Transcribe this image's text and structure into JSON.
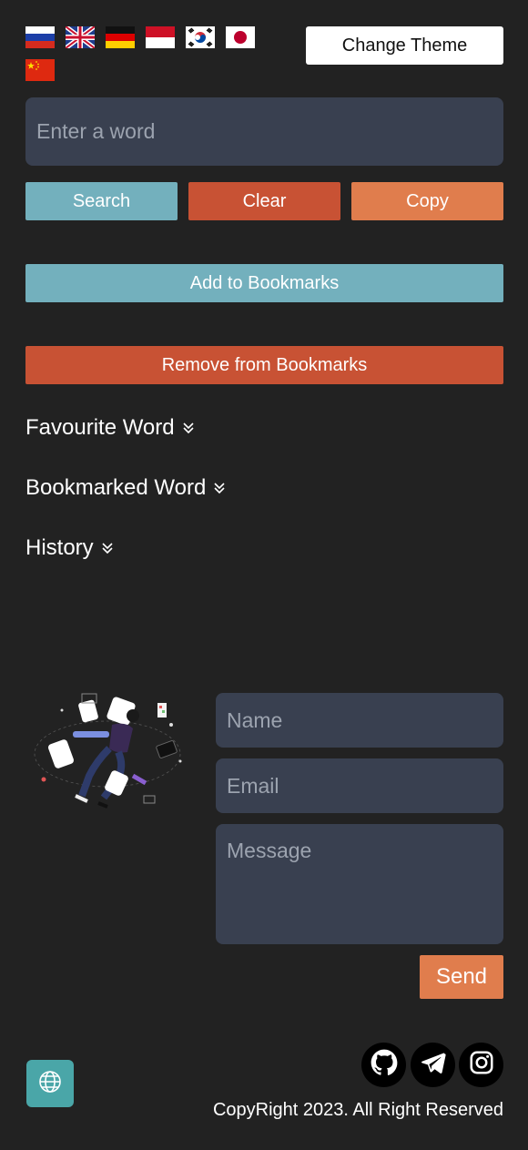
{
  "languages": [
    {
      "code": "ru",
      "icon": "russia-flag-icon"
    },
    {
      "code": "en",
      "icon": "uk-flag-icon"
    },
    {
      "code": "de",
      "icon": "germany-flag-icon"
    },
    {
      "code": "id",
      "icon": "indonesia-flag-icon"
    },
    {
      "code": "ko",
      "icon": "south-korea-flag-icon"
    },
    {
      "code": "ja",
      "icon": "japan-flag-icon"
    },
    {
      "code": "zh",
      "icon": "china-flag-icon"
    }
  ],
  "header": {
    "theme_button_label": "Change Theme"
  },
  "search": {
    "placeholder": "Enter a word",
    "value": ""
  },
  "actions": {
    "search_label": "Search",
    "clear_label": "Clear",
    "copy_label": "Copy",
    "add_bookmark_label": "Add to Bookmarks",
    "remove_bookmark_label": "Remove from Bookmarks"
  },
  "sections": {
    "favourite_label": "Favourite Word",
    "bookmarked_label": "Bookmarked Word",
    "history_label": "History"
  },
  "contact": {
    "name_placeholder": "Name",
    "email_placeholder": "Email",
    "message_placeholder": "Message",
    "send_label": "Send"
  },
  "footer": {
    "copyright": "CopyRight 2023. All Right Reserved",
    "social_icons": [
      "github-icon",
      "telegram-icon",
      "instagram-icon"
    ],
    "language_icon": "globe-icon"
  },
  "colors": {
    "background": "#222222",
    "input_bg": "#394050",
    "teal": "#73b0bd",
    "red": "#c85234",
    "orange": "#e07d4d",
    "globe_bg": "#4aa6a8"
  }
}
